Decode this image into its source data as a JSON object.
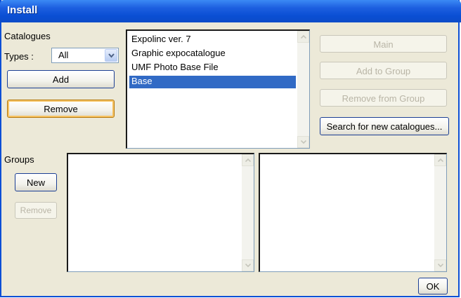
{
  "window": {
    "title": "Install"
  },
  "catalogues": {
    "section_label": "Catalogues",
    "types_label": "Types :",
    "types_value": "All",
    "add_label": "Add",
    "remove_label": "Remove",
    "items": [
      {
        "label": "Expolinc ver. 7",
        "selected": false
      },
      {
        "label": "Graphic expocatalogue",
        "selected": false
      },
      {
        "label": "UMF Photo Base File",
        "selected": false
      },
      {
        "label": "Base",
        "selected": true
      }
    ]
  },
  "actions": {
    "main_label": "Main",
    "add_to_group_label": "Add to Group",
    "remove_from_group_label": "Remove from Group",
    "search_label": "Search for new catalogues..."
  },
  "groups": {
    "section_label": "Groups",
    "new_label": "New",
    "remove_label": "Remove"
  },
  "footer": {
    "ok_label": "OK"
  },
  "icons": {
    "dropdown": "chevron-down-icon",
    "scroll_up": "arrow-up-icon",
    "scroll_down": "arrow-down-icon"
  },
  "colors": {
    "titlebar": "#0a4fd4",
    "dialog_bg": "#ece9d8",
    "selection": "#316ac5",
    "disabled_text": "#b9b5a6"
  }
}
